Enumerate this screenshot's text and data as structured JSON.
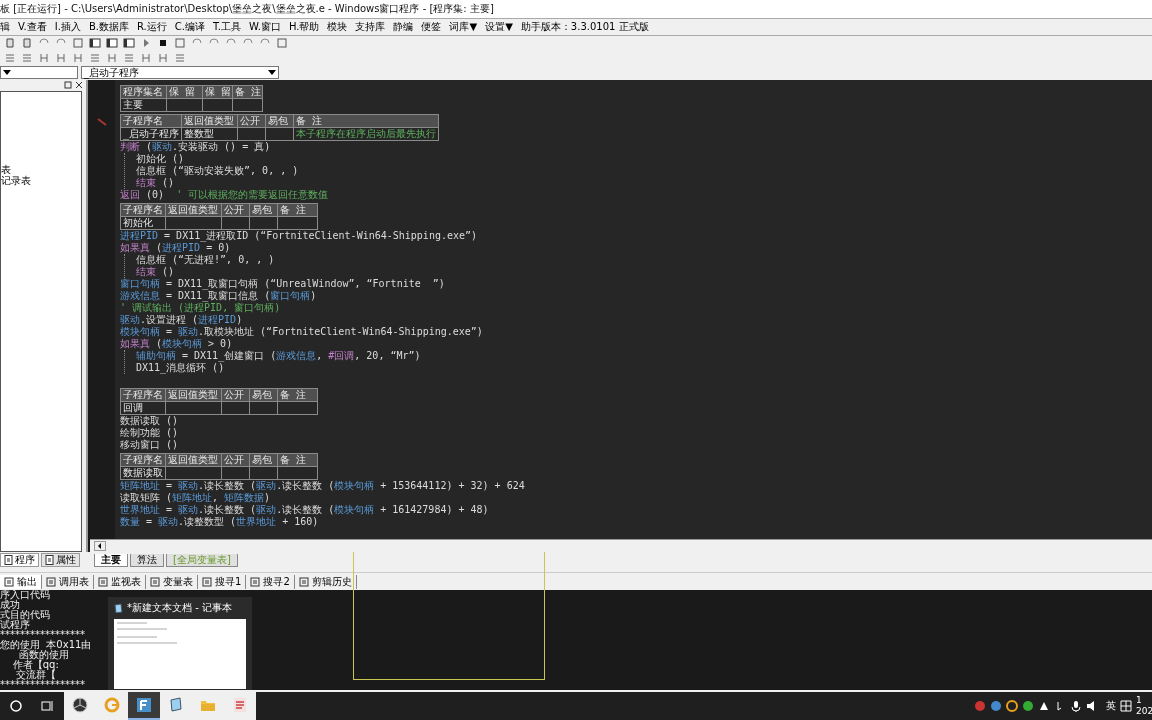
{
  "window": {
    "title": "板 [正在运行] - C:\\Users\\Administrator\\Desktop\\堡垒之夜\\堡垒之夜.e - Windows窗口程序 - [程序集: 主要]"
  },
  "menu": [
    "辑",
    "V.查看",
    "I.插入",
    "B.数据库",
    "R.运行",
    "C.编译",
    "T.工具",
    "W.窗口",
    "H.帮助",
    "模块",
    "支持库",
    "静编",
    "便签",
    "词库▼",
    "设置▼",
    "助手版本：3.3.0101 正式版"
  ],
  "procedure_selector": {
    "value": "_启动子程序"
  },
  "side_panel": {
    "items": [
      "表",
      "记录表"
    ],
    "tabs": [
      {
        "label": "程序",
        "selected": true
      },
      {
        "label": "属性",
        "selected": false
      }
    ]
  },
  "code": [
    {
      "kind": "assembly_table",
      "header": [
        "程序集名",
        "保 留",
        "保 留",
        "备 注"
      ],
      "row": {
        "name": "主要"
      }
    },
    {
      "kind": "sub_table",
      "header": [
        "子程序名",
        "返回值类型",
        "公开",
        "易包",
        "备 注"
      ],
      "row": {
        "name": "_启动子程序",
        "return_type": "整数型",
        "remark": "本子程序在程序启动后最先执行"
      }
    },
    {
      "kind": "line",
      "tokens": [
        {
          "kind": "flow",
          "text": "判断"
        },
        {
          "kind": "plain",
          "text": " ("
        },
        {
          "kind": "kw",
          "text": "驱动"
        },
        {
          "kind": "plain",
          "text": ".安装驱动 () = 真)"
        }
      ],
      "children": [
        {
          "kind": "line",
          "tokens": [
            {
              "kind": "plain",
              "text": "初始化 ()"
            }
          ]
        },
        {
          "kind": "line",
          "tokens": [
            {
              "kind": "plain",
              "text": "信息框 (“驱动安装失败”, 0, , )"
            }
          ]
        },
        {
          "kind": "line",
          "tokens": [
            {
              "kind": "flow",
              "text": "结束"
            },
            {
              "kind": "plain",
              "text": " ()"
            }
          ]
        }
      ]
    },
    {
      "kind": "line",
      "tokens": [
        {
          "kind": "flow",
          "text": "返回"
        },
        {
          "kind": "plain",
          "text": " (0)  "
        },
        {
          "kind": "comment",
          "text": "' 可以根据您的需要返回任意数值"
        }
      ]
    },
    {
      "kind": "sub_table",
      "header": [
        "子程序名",
        "返回值类型",
        "公开",
        "易包",
        "备 注"
      ],
      "row": {
        "name": "初始化"
      }
    },
    {
      "kind": "line",
      "tokens": [
        {
          "kind": "var",
          "text": "进程PID"
        },
        {
          "kind": "plain",
          "text": " = DX11_进程取ID (“FortniteClient-Win64-Shipping.exe”)"
        }
      ]
    },
    {
      "kind": "line",
      "tokens": [
        {
          "kind": "flow",
          "text": "如果真"
        },
        {
          "kind": "plain",
          "text": " ("
        },
        {
          "kind": "var",
          "text": "进程PID"
        },
        {
          "kind": "plain",
          "text": " = 0)"
        }
      ],
      "children": [
        {
          "kind": "line",
          "tokens": [
            {
              "kind": "plain",
              "text": "信息框 (“无进程!”, 0, , )"
            }
          ]
        },
        {
          "kind": "line",
          "tokens": [
            {
              "kind": "flow",
              "text": "结束"
            },
            {
              "kind": "plain",
              "text": " ()"
            }
          ]
        }
      ]
    },
    {
      "kind": "line",
      "tokens": [
        {
          "kind": "var",
          "text": "窗口句柄"
        },
        {
          "kind": "plain",
          "text": " = DX11_取窗口句柄 (“UnrealWindow”, “Fortnite  ”)"
        }
      ]
    },
    {
      "kind": "line",
      "tokens": [
        {
          "kind": "var",
          "text": "游戏信息"
        },
        {
          "kind": "plain",
          "text": " = DX11_取窗口信息 ("
        },
        {
          "kind": "var",
          "text": "窗口句柄"
        },
        {
          "kind": "plain",
          "text": ")"
        }
      ]
    },
    {
      "kind": "line",
      "tokens": [
        {
          "kind": "comment",
          "text": "' 调试输出 (进程PID, 窗口句柄)"
        }
      ]
    },
    {
      "kind": "line",
      "tokens": [
        {
          "kind": "kw",
          "text": "驱动"
        },
        {
          "kind": "plain",
          "text": ".设置进程 ("
        },
        {
          "kind": "var",
          "text": "进程PID"
        },
        {
          "kind": "plain",
          "text": ")"
        }
      ]
    },
    {
      "kind": "line",
      "tokens": [
        {
          "kind": "var",
          "text": "模块句柄"
        },
        {
          "kind": "plain",
          "text": " = "
        },
        {
          "kind": "kw",
          "text": "驱动"
        },
        {
          "kind": "plain",
          "text": ".取模块地址 (“FortniteClient-Win64-Shipping.exe”)"
        }
      ]
    },
    {
      "kind": "line",
      "tokens": [
        {
          "kind": "flow",
          "text": "如果真"
        },
        {
          "kind": "plain",
          "text": " ("
        },
        {
          "kind": "var",
          "text": "模块句柄"
        },
        {
          "kind": "plain",
          "text": " > 0)"
        }
      ],
      "children": [
        {
          "kind": "line",
          "tokens": [
            {
              "kind": "var",
              "text": "辅助句柄"
            },
            {
              "kind": "plain",
              "text": " = DX11_创建窗口 ("
            },
            {
              "kind": "var",
              "text": "游戏信息"
            },
            {
              "kind": "plain",
              "text": ", "
            },
            {
              "kind": "flow",
              "text": "#回调"
            },
            {
              "kind": "plain",
              "text": ", 20, “Mr”)"
            }
          ]
        },
        {
          "kind": "line",
          "tokens": [
            {
              "kind": "plain",
              "text": "DX11_消息循环 ()"
            }
          ]
        }
      ]
    },
    {
      "kind": "blank"
    },
    {
      "kind": "sub_table",
      "header": [
        "子程序名",
        "返回值类型",
        "公开",
        "易包",
        "备 注"
      ],
      "row": {
        "name": "回调"
      }
    },
    {
      "kind": "line",
      "tokens": [
        {
          "kind": "plain",
          "text": "数据读取 ()"
        }
      ]
    },
    {
      "kind": "line",
      "tokens": [
        {
          "kind": "plain",
          "text": "绘制功能 ()"
        }
      ]
    },
    {
      "kind": "line",
      "tokens": [
        {
          "kind": "plain",
          "text": "移动窗口 ()"
        }
      ]
    },
    {
      "kind": "sub_table",
      "header": [
        "子程序名",
        "返回值类型",
        "公开",
        "易包",
        "备 注"
      ],
      "row": {
        "name": "数据读取"
      }
    },
    {
      "kind": "line",
      "tokens": [
        {
          "kind": "var",
          "text": "矩阵地址"
        },
        {
          "kind": "plain",
          "text": " = "
        },
        {
          "kind": "kw",
          "text": "驱动"
        },
        {
          "kind": "plain",
          "text": ".读长整数 ("
        },
        {
          "kind": "kw",
          "text": "驱动"
        },
        {
          "kind": "plain",
          "text": ".读长整数 ("
        },
        {
          "kind": "var",
          "text": "模块句柄"
        },
        {
          "kind": "plain",
          "text": " + 153644112) + 32) + 624"
        }
      ]
    },
    {
      "kind": "line",
      "tokens": [
        {
          "kind": "plain",
          "text": "读取矩阵 ("
        },
        {
          "kind": "var",
          "text": "矩阵地址"
        },
        {
          "kind": "plain",
          "text": ", "
        },
        {
          "kind": "var",
          "text": "矩阵数据"
        },
        {
          "kind": "plain",
          "text": ")"
        }
      ]
    },
    {
      "kind": "line",
      "tokens": [
        {
          "kind": "var",
          "text": "世界地址"
        },
        {
          "kind": "plain",
          "text": " = "
        },
        {
          "kind": "kw",
          "text": "驱动"
        },
        {
          "kind": "plain",
          "text": ".读长整数 ("
        },
        {
          "kind": "kw",
          "text": "驱动"
        },
        {
          "kind": "plain",
          "text": ".读长整数 ("
        },
        {
          "kind": "var",
          "text": "模块句柄"
        },
        {
          "kind": "plain",
          "text": " + 161427984) + 48)"
        }
      ]
    },
    {
      "kind": "line",
      "tokens": [
        {
          "kind": "var",
          "text": "数量"
        },
        {
          "kind": "plain",
          "text": " = "
        },
        {
          "kind": "kw",
          "text": "驱动"
        },
        {
          "kind": "plain",
          "text": ".读整数型 ("
        },
        {
          "kind": "var",
          "text": "世界地址"
        },
        {
          "kind": "plain",
          "text": " + 160)"
        }
      ]
    }
  ],
  "code_tabs": [
    {
      "label": "主要",
      "selected": true,
      "kind": "module"
    },
    {
      "label": "算法",
      "selected": false,
      "kind": "module"
    },
    {
      "label": "[全局变量表]",
      "selected": false,
      "kind": "globals"
    }
  ],
  "bottom_tabs": [
    {
      "label": "输出",
      "selected": true
    },
    {
      "label": "调用表",
      "selected": false
    },
    {
      "label": "监视表",
      "selected": false
    },
    {
      "label": "变量表",
      "selected": false
    },
    {
      "label": "搜寻1",
      "selected": false
    },
    {
      "label": "搜寻2",
      "selected": false
    },
    {
      "label": "剪辑历史",
      "selected": false
    }
  ],
  "output": [
    "序入口代码",
    "成功",
    "式目的代码",
    "试程序",
    "*****************",
    "您的使用  本0x11由",
    "      函数的使用",
    "    作者【qq:",
    "     交流群【",
    "*****************"
  ],
  "taskbar_preview": {
    "title": "*新建文本文档 - 记事本"
  },
  "taskbar": {
    "apps": [
      {
        "kind": "aperture",
        "selected": false
      },
      {
        "kind": "ring",
        "selected": false
      },
      {
        "kind": "tile",
        "selected": true
      },
      {
        "kind": "notepad",
        "selected": false
      },
      {
        "kind": "folder",
        "selected": false
      },
      {
        "kind": "document",
        "selected": false
      }
    ],
    "input_method": "英",
    "clock": [
      "1",
      "202"
    ]
  }
}
